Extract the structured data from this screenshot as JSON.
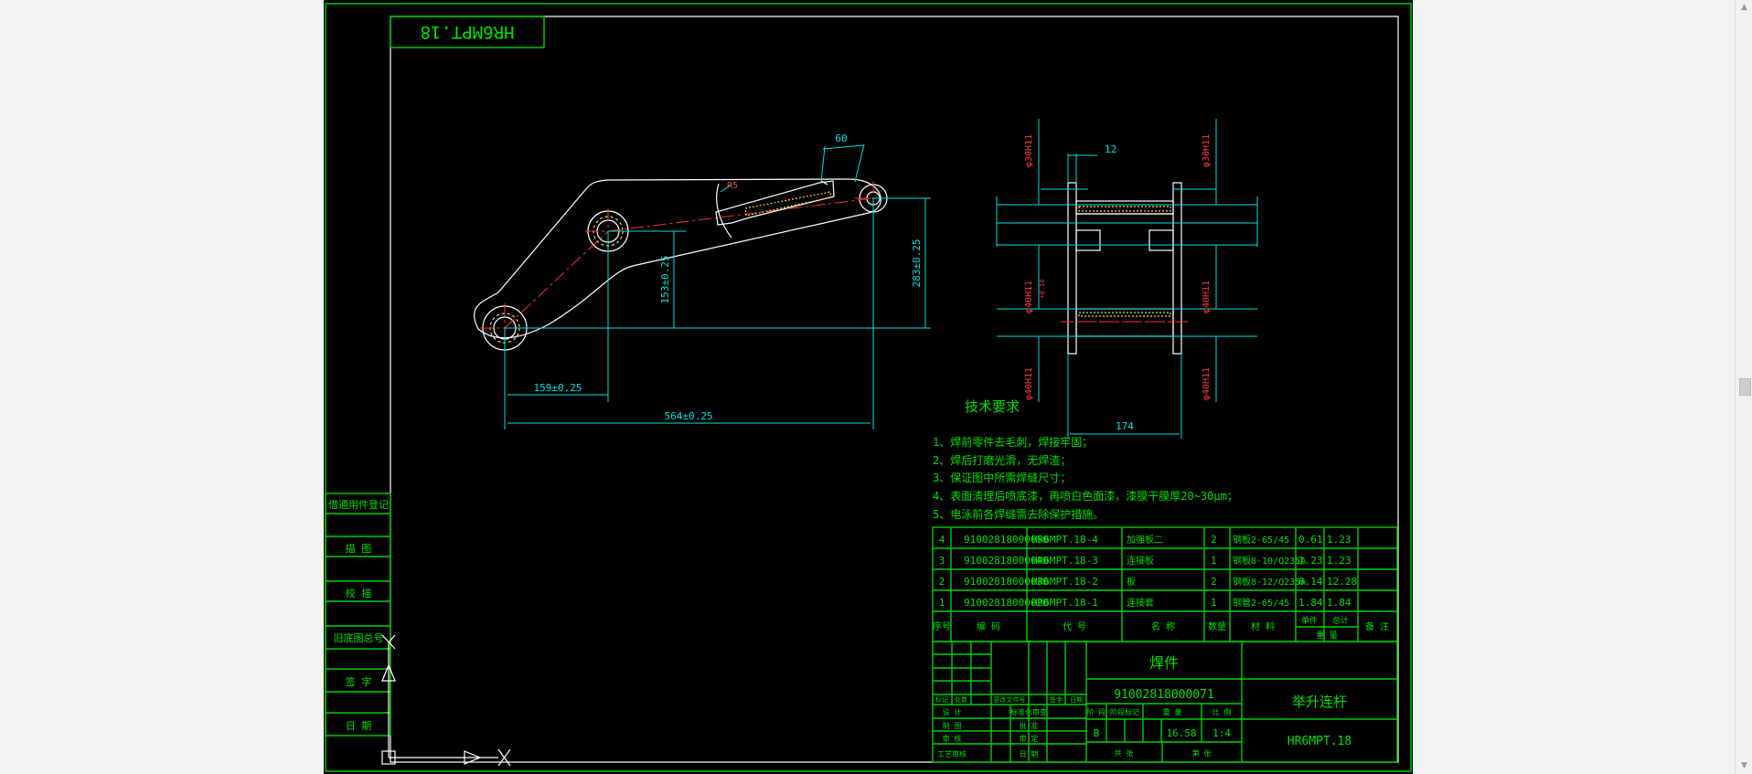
{
  "colors": {
    "background": "#000000",
    "frame": "#00d000",
    "outline": "#ffffff",
    "dimension": "#00e0e0",
    "centerline": "#ff3030",
    "tolerance_text": "#ff3a3a",
    "weld": "#ffd24a",
    "viewport_bg": "#f3f3f3"
  },
  "title_stamp": {
    "mirrored_code": "HR6MPT.18"
  },
  "dimensions": {
    "angle_top": "60",
    "radius_small": "R5",
    "height_inner": "153±0.25",
    "height_outer": "283±0.25",
    "width_inner": "159±0.25",
    "width_outer": "564±0.25",
    "section_width_top": "12",
    "section_width_bottom": "174",
    "bore_top_left": "φ30H11",
    "bore_top_right": "φ30H11",
    "bore_mid_left": "φ40H11",
    "bore_mid_right": "φ40H11",
    "bore_bot_left": "φ40H11",
    "bore_bot_right": "φ40H11",
    "tolerance_label": "+0.16"
  },
  "requirements": {
    "title": "技术要求",
    "items": [
      "1、焊前零件去毛刺，焊接牢固；",
      "2、焊后打磨光滑，无焊渣；",
      "3、保证图中所需焊缝尺寸；",
      "4、表面清理后喷底漆，再喷白色面漆，漆膜干膜厚20~30μm；",
      "5、电泳前各焊缝需去除保护措施。"
    ]
  },
  "side_panel": {
    "labels": [
      "借通用件登记",
      "描 图",
      "校 描",
      "旧底图总号",
      "签 字",
      "日 期"
    ]
  },
  "bom": {
    "rows": [
      {
        "seq": "4",
        "code": "91002818000050",
        "drawing": "HR6MPT.18-4",
        "name": "加强板二",
        "qty": "2",
        "material": "钢板2-65/45",
        "unit_w": "0.61",
        "total_w": "1.23",
        "note": ""
      },
      {
        "seq": "3",
        "code": "91002818000040",
        "drawing": "HR6MPT.18-3",
        "name": "连接板",
        "qty": "1",
        "material": "钢板8-10/Q235A",
        "unit_w": "1.23",
        "total_w": "1.23",
        "note": ""
      },
      {
        "seq": "2",
        "code": "91002818000030",
        "drawing": "HR6MPT.18-2",
        "name": "板",
        "qty": "2",
        "material": "钢板8-12/Q235A",
        "unit_w": "6.14",
        "total_w": "12.28",
        "note": ""
      },
      {
        "seq": "1",
        "code": "91002818000020",
        "drawing": "HR6MPT.18-1",
        "name": "连接套",
        "qty": "1",
        "material": "钢管2-65/45",
        "unit_w": "1.84",
        "total_w": "1.84",
        "note": ""
      }
    ],
    "header": {
      "seq": "序号",
      "code": "编 码",
      "drawing": "代 号",
      "name": "名 称",
      "qty": "数量",
      "material": "材 料",
      "unit": "单件",
      "total": "总计",
      "weight": "重 量",
      "note": "备 注"
    }
  },
  "title_block": {
    "part_type": "焊件",
    "code": "91002818000071",
    "part_name": "举升连杆",
    "drawing_no": "HR6MPT.18",
    "stage_mark": "B",
    "mass": "16.58",
    "scale": "1:4",
    "row_labels": [
      "设 计",
      "制 图",
      "审 核",
      "工艺审核"
    ],
    "rev_labels": [
      "标记",
      "处数",
      "更改文件号",
      "签字",
      "日期"
    ],
    "mid_labels": [
      "标准化审查",
      "批 准",
      "审 定",
      "日 期"
    ],
    "meta_headers": [
      "阶 段",
      "阶段标记",
      "重 量",
      "比 例"
    ],
    "sheet_labels": [
      "共 张",
      "第 张"
    ]
  }
}
